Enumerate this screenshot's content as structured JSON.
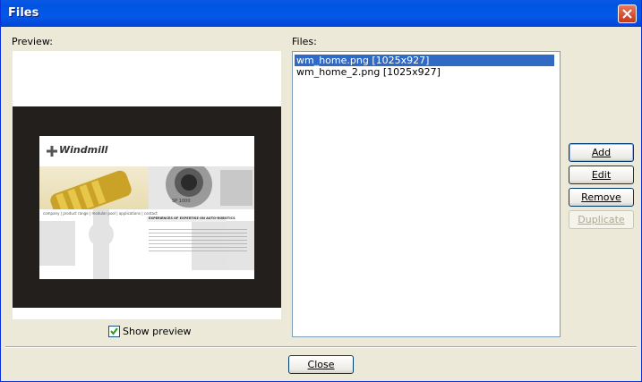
{
  "window": {
    "title": "Files"
  },
  "preview": {
    "label": "Preview:",
    "show_preview_label": "Show preview",
    "show_preview_checked": true
  },
  "files": {
    "label": "Files:",
    "items": [
      {
        "text": "wm_home.png [1025x927]",
        "selected": true
      },
      {
        "text": "wm_home_2.png [1025x927]",
        "selected": false
      }
    ]
  },
  "buttons": {
    "add": "Add",
    "edit": "Edit",
    "remove": "Remove",
    "duplicate": "Duplicate",
    "close": "Close"
  },
  "thumbnail": {
    "logo": "Windmill",
    "nav": "company | product range | modular pool | applications | contact",
    "heading": "EXPERIENCES OF EXPERTISE ON AUTO-ROBOTICS",
    "camera_text": "SP 1000"
  },
  "colors": {
    "titlebar": "#0054e3",
    "selection": "#316ac5",
    "dialog_bg": "#ece9d8",
    "preview_dark": "#231f1c"
  }
}
